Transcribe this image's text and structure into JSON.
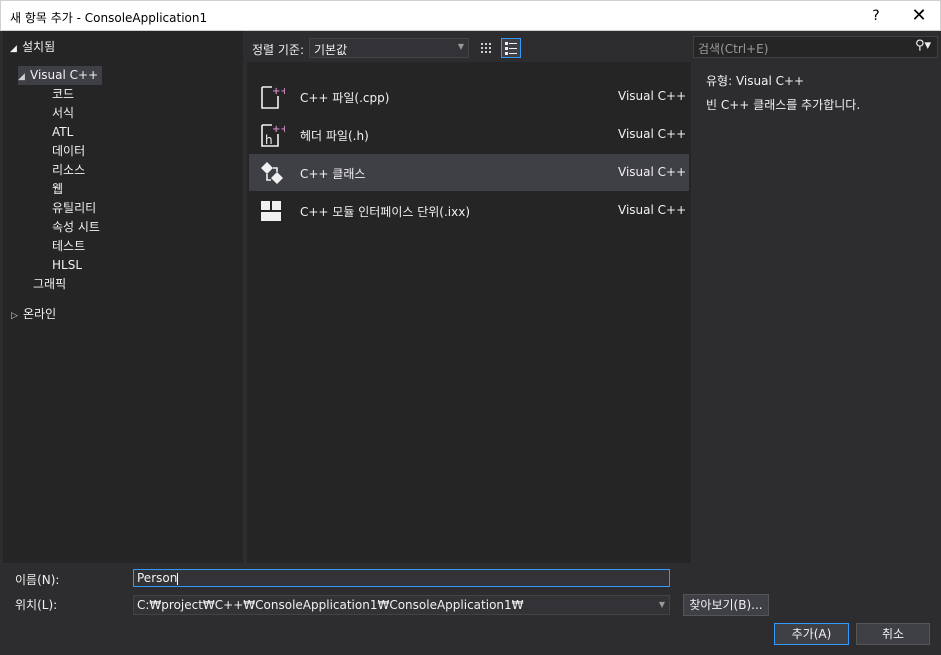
{
  "window": {
    "title": "새 항목 추가 - ConsoleApplication1",
    "help_label": "?",
    "close_label": "✕"
  },
  "tree": {
    "header": "설치됨",
    "root": "Visual C++",
    "children": [
      "코드",
      "서식",
      "ATL",
      "데이터",
      "리소스",
      "웹",
      "유틸리티",
      "속성 시트",
      "테스트",
      "HLSL"
    ],
    "sibling": "그래픽",
    "online": "온라인"
  },
  "sort": {
    "label": "정렬 기준:",
    "value": "기본값"
  },
  "search": {
    "placeholder": "검색(Ctrl+E)"
  },
  "templates": [
    {
      "name": "C++ 파일(.cpp)",
      "lang": "Visual C++",
      "icon": "cpp-file-icon"
    },
    {
      "name": "헤더 파일(.h)",
      "lang": "Visual C++",
      "icon": "header-file-icon"
    },
    {
      "name": "C++ 클래스",
      "lang": "Visual C++",
      "icon": "cpp-class-icon"
    },
    {
      "name": "C++ 모듈 인터페이스 단위(.ixx)",
      "lang": "Visual C++",
      "icon": "module-interface-icon"
    }
  ],
  "info": {
    "type_label": "유형:",
    "type_value": "Visual C++",
    "description": "빈 C++ 클래스를 추가합니다."
  },
  "form": {
    "name_label": "이름(N):",
    "name_value": "Person",
    "location_label": "위치(L):",
    "location_value": "C:₩project₩C++₩ConsoleApplication1₩ConsoleApplication1₩",
    "browse_label": "찾아보기(B)...",
    "add_label": "추가(A)",
    "cancel_label": "취소"
  },
  "colors": {
    "accent": "#3399ff",
    "cpp_plus": "#c586c0"
  }
}
